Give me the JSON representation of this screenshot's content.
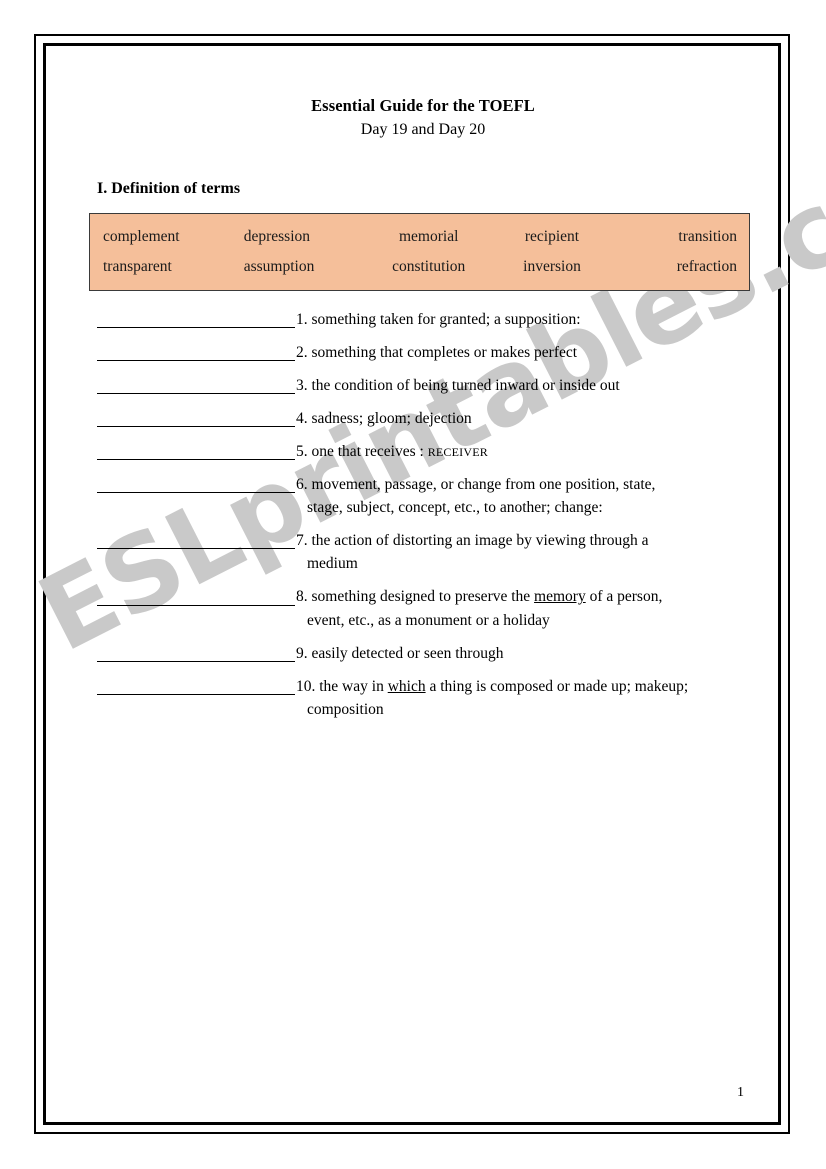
{
  "document": {
    "title": "Essential Guide for the TOEFL",
    "subtitle": "Day 19 and Day 20",
    "section_heading": "I. Definition of terms",
    "page_number": "1",
    "watermark": "ESLprintables.com"
  },
  "theme": {
    "wordbank_background": "#f5bf9a",
    "wordbank_border": "#3a3a3a",
    "frame_color": "#000000",
    "watermark_color": "#c9c9c9",
    "text_color": "#000000"
  },
  "wordbank": {
    "rows": [
      [
        "complement",
        "depression",
        "memorial",
        "recipient",
        "transition"
      ],
      [
        "transparent",
        "assumption",
        "constitution",
        "inversion",
        "refraction"
      ]
    ]
  },
  "items": [
    {
      "number": "1.",
      "line1_pre": " something taken for granted; a supposition:",
      "underline": "",
      "line1_post": "",
      "smallcaps": "",
      "line2": ""
    },
    {
      "number": "2.",
      "line1_pre": " something that completes or makes perfect",
      "underline": "",
      "line1_post": "",
      "smallcaps": "",
      "line2": ""
    },
    {
      "number": "3.",
      "line1_pre": " the condition of being turned inward or inside out",
      "underline": "",
      "line1_post": "",
      "smallcaps": "",
      "line2": ""
    },
    {
      "number": "4.",
      "line1_pre": " sadness; gloom; dejection",
      "underline": "",
      "line1_post": "",
      "smallcaps": "",
      "line2": ""
    },
    {
      "number": "5.",
      "line1_pre": " one that receives : ",
      "underline": "",
      "line1_post": "",
      "smallcaps": "RECEIVER",
      "line2": ""
    },
    {
      "number": "6.",
      "line1_pre": " movement, passage, or change from one position, state,",
      "underline": "",
      "line1_post": "",
      "smallcaps": "",
      "line2": "stage, subject, concept, etc., to another; change:"
    },
    {
      "number": "7.",
      "line1_pre": " the action of distorting an image by viewing through a",
      "underline": "",
      "line1_post": "",
      "smallcaps": "",
      "line2": "medium"
    },
    {
      "number": "8.",
      "line1_pre": " something designed to preserve the ",
      "underline": "memory",
      "line1_post": " of a person,",
      "smallcaps": "",
      "line2": "event, etc., as a monument or a holiday"
    },
    {
      "number": "9.",
      "line1_pre": " easily detected or seen through",
      "underline": "",
      "line1_post": "",
      "smallcaps": "",
      "line2": ""
    },
    {
      "number": "10.",
      "line1_pre": " the way in ",
      "underline": "which",
      "line1_post": " a thing is composed or made up; makeup;",
      "smallcaps": "",
      "line2": "composition"
    }
  ]
}
